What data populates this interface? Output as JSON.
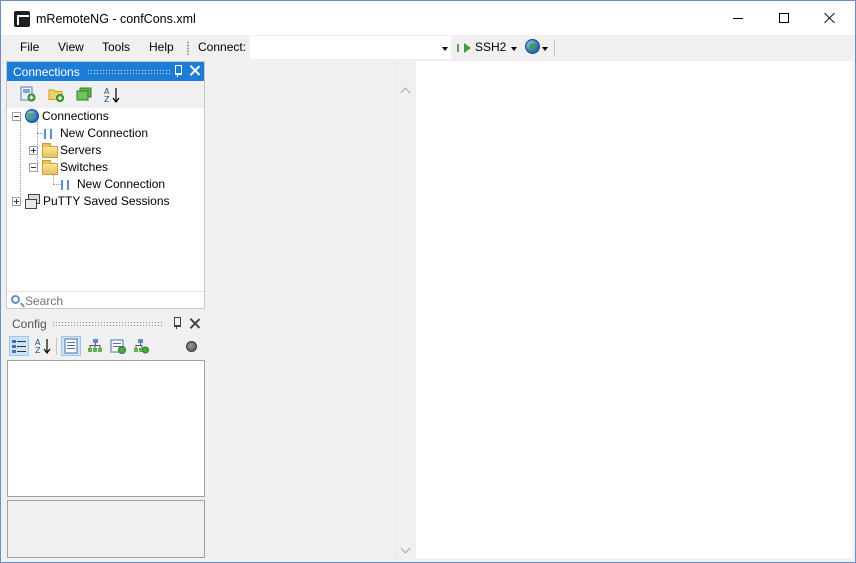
{
  "window": {
    "title": "mRemoteNG - confCons.xml"
  },
  "menu": {
    "file": "File",
    "view": "View",
    "tools": "Tools",
    "help": "Help"
  },
  "toolbar": {
    "connect_label": "Connect:",
    "connect_value": "",
    "protocol": "SSH2"
  },
  "connections_panel": {
    "title": "Connections",
    "search_placeholder": "Search",
    "tree": [
      {
        "label": "Connections",
        "type": "root",
        "expanded": true
      },
      {
        "label": "New Connection",
        "type": "connection"
      },
      {
        "label": "Servers",
        "type": "folder",
        "expanded": false
      },
      {
        "label": "Switches",
        "type": "folder",
        "expanded": true
      },
      {
        "label": "New Connection",
        "type": "connection"
      },
      {
        "label": "PuTTY Saved Sessions",
        "type": "putty",
        "expanded": false
      }
    ]
  },
  "config_panel": {
    "title": "Config"
  },
  "colors": {
    "active_header": "#1c7cd6",
    "panel_bg": "#f0f0f0",
    "ssh_icon": "#3c9d3c"
  }
}
